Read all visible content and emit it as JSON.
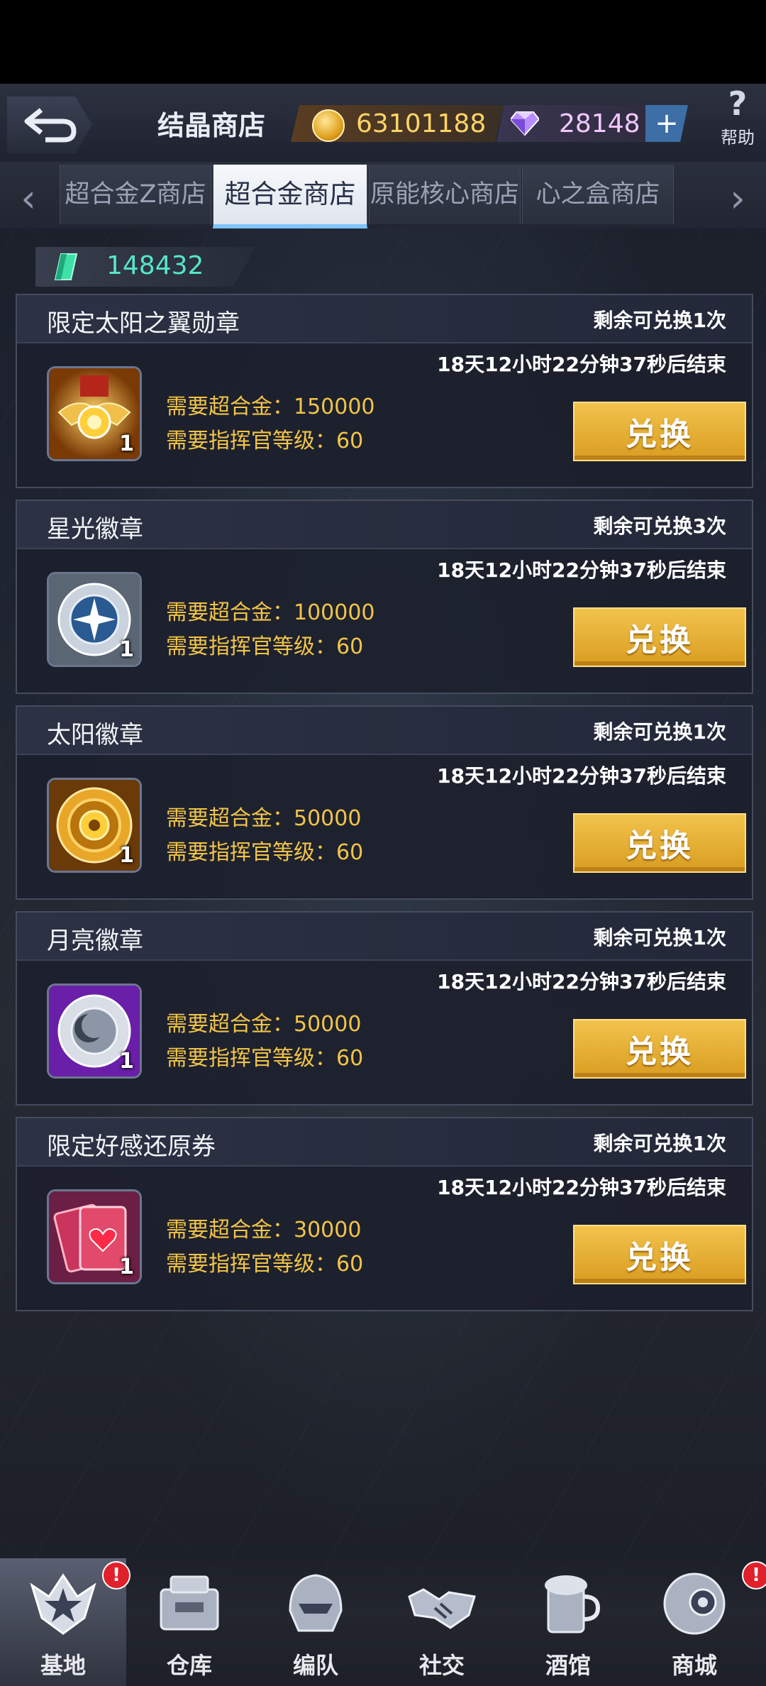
{
  "header": {
    "title": "结晶商店",
    "gold_amount": "63101188",
    "gem_amount": "28148",
    "plus_label": "+",
    "help_label": "帮助",
    "help_icon_glyph": "?"
  },
  "tabs": [
    {
      "label": "超合金Z商店",
      "active": false
    },
    {
      "label": "超合金商店",
      "active": true
    },
    {
      "label": "原能核心商店",
      "active": false
    },
    {
      "label": "心之盒商店",
      "active": false
    }
  ],
  "tab_arrows": {
    "left": "‹",
    "right": "›"
  },
  "balance": {
    "value": "148432",
    "icon": "alloy-crystal-icon"
  },
  "items": [
    {
      "name": "限定太阳之翼勋章",
      "remaining": "剩余可兑换1次",
      "timer": "18天12小时22分钟37秒后结束",
      "qty": "1",
      "cost": "需要超合金：150000",
      "level": "需要指挥官等级：60",
      "button": "兑换",
      "icon": "sun-wing-medal-icon"
    },
    {
      "name": "星光徽章",
      "remaining": "剩余可兑换3次",
      "timer": "18天12小时22分钟37秒后结束",
      "qty": "1",
      "cost": "需要超合金：100000",
      "level": "需要指挥官等级：60",
      "button": "兑换",
      "icon": "starlight-badge-icon"
    },
    {
      "name": "太阳徽章",
      "remaining": "剩余可兑换1次",
      "timer": "18天12小时22分钟37秒后结束",
      "qty": "1",
      "cost": "需要超合金：50000",
      "level": "需要指挥官等级：60",
      "button": "兑换",
      "icon": "sun-badge-icon"
    },
    {
      "name": "月亮徽章",
      "remaining": "剩余可兑换1次",
      "timer": "18天12小时22分钟37秒后结束",
      "qty": "1",
      "cost": "需要超合金：50000",
      "level": "需要指挥官等级：60",
      "button": "兑换",
      "icon": "moon-badge-icon"
    },
    {
      "name": "限定好感还原券",
      "remaining": "剩余可兑换1次",
      "timer": "18天12小时22分钟37秒后结束",
      "qty": "1",
      "cost": "需要超合金：30000",
      "level": "需要指挥官等级：60",
      "button": "兑换",
      "icon": "affection-reset-ticket-icon"
    }
  ],
  "nav": [
    {
      "label": "基地",
      "active": true,
      "badge": "!"
    },
    {
      "label": "仓库",
      "active": false
    },
    {
      "label": "编队",
      "active": false
    },
    {
      "label": "社交",
      "active": false
    },
    {
      "label": "酒馆",
      "active": false
    },
    {
      "label": "商城",
      "active": false,
      "badge": "!"
    }
  ],
  "colors": {
    "accent_gold": "#f2c448",
    "button_gold": "#d99d21",
    "balance_cyan": "#57e6c8",
    "badge_red": "#e0202a"
  }
}
